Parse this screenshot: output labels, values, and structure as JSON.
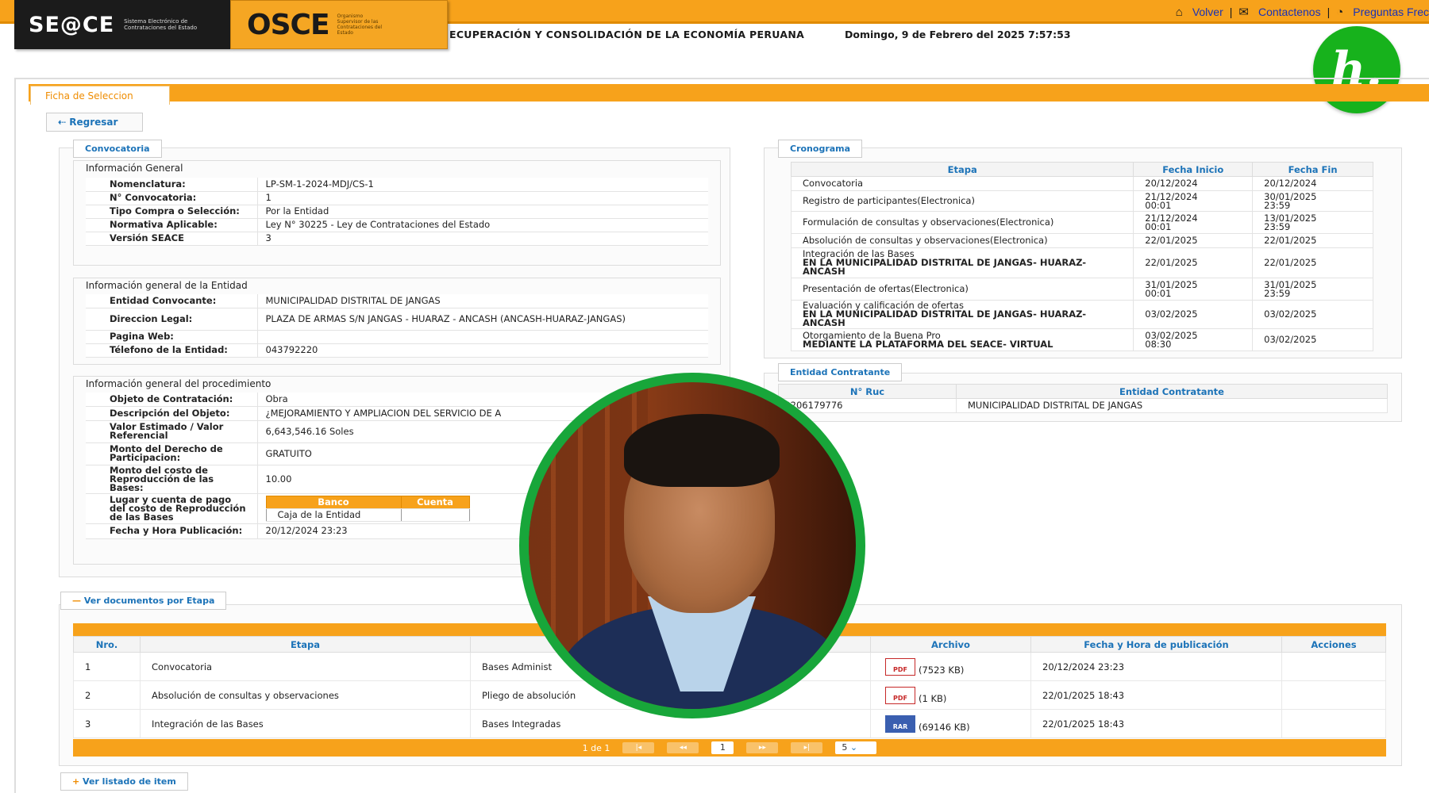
{
  "header": {
    "seace_logo": "SE@CE",
    "seace_subtitle": "Sistema Electrónico de Contrataciones del Estado",
    "osce_logo": "OSCE",
    "osce_subtitle": "Organismo Supervisor de las Contrataciones del Estado",
    "links": {
      "volver": "Volver",
      "contactenos": "Contactenos",
      "preguntas": "Preguntas Frec"
    },
    "slogan": "ECUPERACIÓN Y CONSOLIDACIÓN DE LA ECONOMÍA PERUANA",
    "datetime": "Domingo, 9 de Febrero del 2025 7:57:53",
    "badge": "h."
  },
  "tab": {
    "label": "Ficha de Seleccion"
  },
  "back_button": "Regresar",
  "convocatoria": {
    "legend": "Convocatoria",
    "general_title": "Información General",
    "general": [
      {
        "label": "Nomenclatura:",
        "value": "LP-SM-1-2024-MDJ/CS-1"
      },
      {
        "label": "N° Convocatoria:",
        "value": "1"
      },
      {
        "label": "Tipo Compra o Selección:",
        "value": "Por la Entidad"
      },
      {
        "label": "Normativa Aplicable:",
        "value": "Ley N° 30225 - Ley de Contrataciones del Estado"
      },
      {
        "label": "Versión SEACE",
        "value": "3"
      }
    ],
    "entidad_title": "Información general de la Entidad",
    "entidad": [
      {
        "label": "Entidad Convocante:",
        "value": "MUNICIPALIDAD DISTRITAL DE JANGAS"
      },
      {
        "label": "Direccion Legal:",
        "value": "PLAZA DE ARMAS S/N JANGAS - HUARAZ - ANCASH (ANCASH-HUARAZ-JANGAS)"
      },
      {
        "label": "Pagina Web:",
        "value": ""
      },
      {
        "label": "Télefono de la Entidad:",
        "value": "043792220"
      }
    ],
    "proc_title": "Información general del procedimiento",
    "proc": [
      {
        "label": "Objeto de Contratación:",
        "value": "Obra"
      },
      {
        "label": "Descripción del Objeto:",
        "value": "¿MEJORAMIENTO Y AMPLIACION DEL SERVICIO DE A"
      },
      {
        "label": "Valor Estimado / Valor Referencial",
        "value": "6,643,546.16  Soles"
      },
      {
        "label": "Monto del Derecho de Participacion:",
        "value": "GRATUITO"
      },
      {
        "label": "Monto del costo de Reproducción de las Bases:",
        "value": "10.00"
      },
      {
        "label": "Lugar y cuenta de pago del costo de Reproducción de las Bases",
        "value": ""
      },
      {
        "label": "Fecha y Hora Publicación:",
        "value": "20/12/2024 23:23"
      }
    ],
    "bank": {
      "head_banco": "Banco",
      "head_cuenta": "Cuenta",
      "banco": "Caja de la Entidad",
      "cuenta": ""
    }
  },
  "cronograma": {
    "legend": "Cronograma",
    "headers": [
      "Etapa",
      "Fecha Inicio",
      "Fecha Fin"
    ],
    "rows": [
      {
        "etapa": "Convocatoria",
        "etapa2": "",
        "inicio": "20/12/2024",
        "inicio2": "",
        "fin": "20/12/2024",
        "fin2": ""
      },
      {
        "etapa": "Registro de participantes(Electronica)",
        "etapa2": "",
        "inicio": "21/12/2024",
        "inicio2": "00:01",
        "fin": "30/01/2025",
        "fin2": "23:59"
      },
      {
        "etapa": "Formulación de consultas y observaciones(Electronica)",
        "etapa2": "",
        "inicio": "21/12/2024",
        "inicio2": "00:01",
        "fin": "13/01/2025",
        "fin2": "23:59"
      },
      {
        "etapa": "Absolución de consultas y observaciones(Electronica)",
        "etapa2": "",
        "inicio": "22/01/2025",
        "inicio2": "",
        "fin": "22/01/2025",
        "fin2": ""
      },
      {
        "etapa": "Integración de las Bases",
        "etapa2": "EN LA MUNICIPALIDAD DISTRITAL DE JANGAS- HUARAZ- ANCASH",
        "inicio": "22/01/2025",
        "inicio2": "",
        "fin": "22/01/2025",
        "fin2": ""
      },
      {
        "etapa": "Presentación de ofertas(Electronica)",
        "etapa2": "",
        "inicio": "31/01/2025",
        "inicio2": "00:01",
        "fin": "31/01/2025",
        "fin2": "23:59"
      },
      {
        "etapa": "Evaluación y calificación de ofertas",
        "etapa2": "EN LA MUNICIPALIDAD DISTRITAL DE JANGAS- HUARAZ- ANCASH",
        "inicio": "03/02/2025",
        "inicio2": "",
        "fin": "03/02/2025",
        "fin2": ""
      },
      {
        "etapa": "Otorgamiento de la Buena Pro",
        "etapa2": "MEDIANTE LA PLATAFORMA DEL SEACE- VIRTUAL",
        "inicio": "03/02/2025",
        "inicio2": "08:30",
        "fin": "03/02/2025",
        "fin2": ""
      }
    ]
  },
  "contratante": {
    "legend": "Entidad Contratante",
    "headers": [
      "N° Ruc",
      "Entidad Contratante"
    ],
    "ruc": "20206179776",
    "nombre": "MUNICIPALIDAD DISTRITAL DE JANGAS"
  },
  "documentos": {
    "legend": "Ver documentos por Etapa",
    "headers": [
      "Nro.",
      "Etapa",
      "",
      "Archivo",
      "Fecha y Hora de publicación",
      "Acciones"
    ],
    "rows": [
      {
        "nro": "1",
        "etapa": "Convocatoria",
        "doc": "Bases Administ",
        "tipo": "PDF",
        "size": "(7523 KB)",
        "fecha": "20/12/2024 23:23"
      },
      {
        "nro": "2",
        "etapa": "Absolución de consultas y observaciones",
        "doc": "Pliego de absolución",
        "tipo": "PDF",
        "size": "(1 KB)",
        "fecha": "22/01/2025 18:43"
      },
      {
        "nro": "3",
        "etapa": "Integración de las Bases",
        "doc": "Bases Integradas",
        "tipo": "RAR",
        "size": "(69146 KB)",
        "fecha": "22/01/2025 18:43"
      }
    ],
    "pager": {
      "info": "1 de 1",
      "current": "1",
      "per_page": "5"
    }
  },
  "items_legend": "Ver listado de item",
  "colors": {
    "accent": "#f7a21b",
    "link": "#1c73b8",
    "badge": "#17b21c"
  }
}
